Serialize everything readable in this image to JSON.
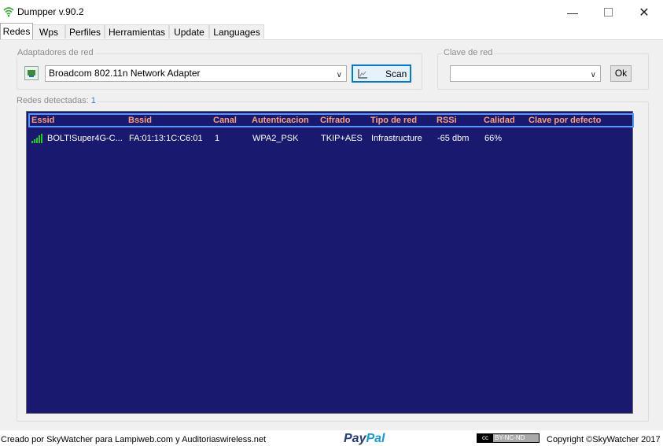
{
  "window": {
    "title": "Dumpper v.90.2",
    "minimize_glyph": "—",
    "close_glyph": "✕"
  },
  "tabs": [
    {
      "label": "Redes",
      "active": true
    },
    {
      "label": "Wps",
      "active": false
    },
    {
      "label": "Perfiles",
      "active": false
    },
    {
      "label": "Herramientas",
      "active": false
    },
    {
      "label": "Update",
      "active": false
    },
    {
      "label": "Languages",
      "active": false
    }
  ],
  "adapters": {
    "group_label": "Adaptadores de red",
    "selected": "Broadcom 802.11n Network Adapter",
    "scan_label": "Scan"
  },
  "network_key": {
    "group_label": "Clave de red",
    "value": "",
    "ok_label": "Ok"
  },
  "networks": {
    "label": "Redes detectadas:",
    "count": "1",
    "columns": [
      "Essid",
      "Bssid",
      "Canal",
      "Autenticacion",
      "Cifrado",
      "Tipo de red",
      "RSSi",
      "Calidad",
      "Clave por defecto"
    ],
    "rows": [
      {
        "essid": "BOLT!Super4G-C...",
        "bssid": "FA:01:13:1C:C6:01",
        "canal": "1",
        "autenticacion": "WPA2_PSK",
        "cifrado": "TKIP+AES",
        "tipo": "Infrastructure",
        "rssi": "-65 dbm",
        "calidad": "66%",
        "clave": ""
      }
    ]
  },
  "footer": {
    "credits": "Creado por SkyWatcher para Lampiweb.com y Auditoriaswireless.net",
    "paypal_a": "Pay",
    "paypal_b": "Pal",
    "cc_badge_a": "cc",
    "cc_badge_b": "BY-NC-ND",
    "copyright": "Copyright ©SkyWatcher 2017"
  },
  "colors": {
    "list_bg": "#191970",
    "header_text": "#ffa07a",
    "header_border": "#5599ff",
    "scan_border": "#0078d7",
    "signal": "#22cc22"
  },
  "icons": {
    "app": "wifi-icon",
    "adapter": "network-adapter-icon",
    "scan": "scan-icon",
    "signal": "signal-bars-icon"
  }
}
